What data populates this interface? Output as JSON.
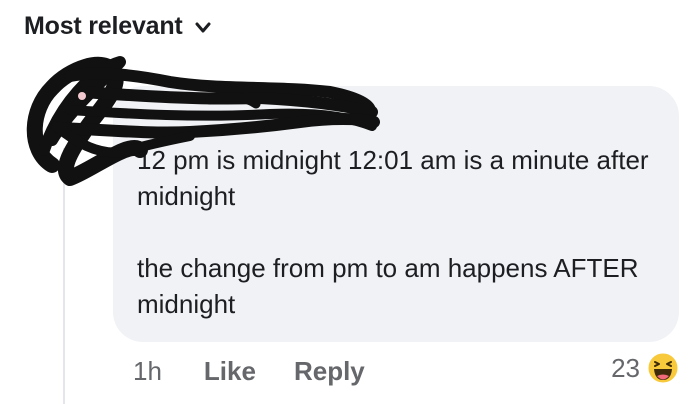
{
  "sort_filter": {
    "label": "Most relevant",
    "icon": "chevron-down-icon"
  },
  "comment": {
    "paragraphs": [
      "12 pm is midnight 12:01 am is a minute after midnight",
      "the change from pm to am happens AFTER midnight"
    ],
    "author_redacted": true
  },
  "actions": {
    "time": "1h",
    "like_label": "Like",
    "reply_label": "Reply"
  },
  "reactions": {
    "count": "23",
    "icon": "haha-reaction-icon"
  },
  "colors": {
    "bubble": "#f0f2f5",
    "text": "#1c1e21",
    "secondary_text": "#65676b",
    "redaction": "#111111"
  }
}
